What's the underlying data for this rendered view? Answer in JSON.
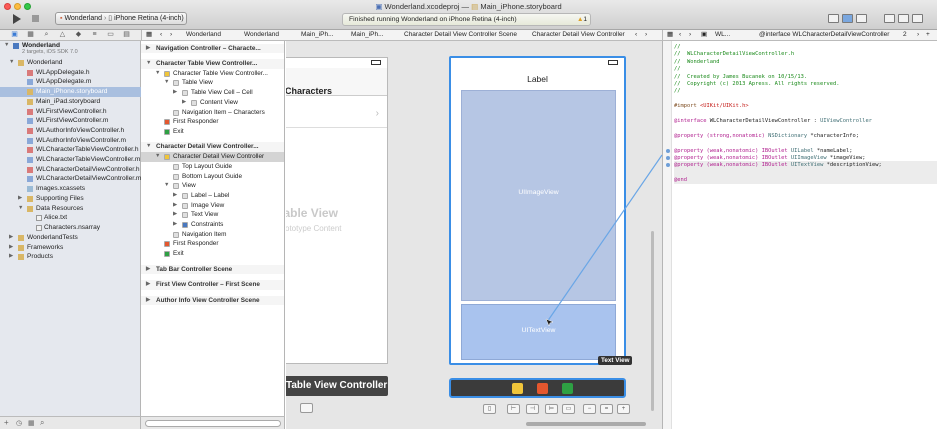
{
  "window": {
    "title_left": "Wonderland.xcodeproj",
    "title_sep": "—",
    "title_right": "Main_iPhone.storyboard"
  },
  "toolbar": {
    "scheme": "Wonderland",
    "destination": "iPhone Retina (4-inch)",
    "activity": "Finished running Wonderland on iPhone Retina (4-inch)",
    "warning_count": "1"
  },
  "jumpbar": {
    "crumbs": [
      "Wonderland",
      "Wonderland",
      "Main_iPh...",
      "Main_iPh...",
      "Character Detail View Controller Scene",
      "Character Detail View Controller"
    ],
    "assistant_crumbs": [
      "WL...",
      "@interface WLCharacterDetailViewController",
      "2"
    ]
  },
  "navigator": {
    "project": "Wonderland",
    "project_sub": "2 targets, iOS SDK 7.0",
    "group": "Wonderland",
    "files": [
      "WLAppDelegate.h",
      "WLAppDelegate.m",
      "Main_iPhone.storyboard",
      "Main_iPad.storyboard",
      "WLFirstViewController.h",
      "WLFirstViewController.m",
      "WLAuthorInfoViewController.h",
      "WLAuthorInfoViewController.m",
      "WLCharacterTableViewController.h",
      "WLCharacterTableViewController.m",
      "WLCharacterDetailViewController.h",
      "WLCharacterDetailViewController.m",
      "Images.xcassets"
    ],
    "supporting": "Supporting Files",
    "data_resources": "Data Resources",
    "data_files": [
      "Alice.txt",
      "Characters.nsarray"
    ],
    "tests": "WonderlandTests",
    "frameworks": "Frameworks",
    "products": "Products"
  },
  "outline": {
    "items": [
      {
        "label": "Navigation Controller – Characte...",
        "level": 0,
        "scene": true
      },
      {
        "label": "Character Table View Controller...",
        "level": 0,
        "scene": true
      },
      {
        "label": "Character Table View Controller...",
        "level": 1
      },
      {
        "label": "Table View",
        "level": 2
      },
      {
        "label": "Table View Cell – Cell",
        "level": 3
      },
      {
        "label": "Content View",
        "level": 4
      },
      {
        "label": "Navigation Item – Characters",
        "level": 2
      },
      {
        "label": "First Responder",
        "level": 1
      },
      {
        "label": "Exit",
        "level": 1
      },
      {
        "label": "Character Detail View Controller...",
        "level": 0,
        "scene": true
      },
      {
        "label": "Character Detail View Controller",
        "level": 1,
        "selected": true
      },
      {
        "label": "Top Layout Guide",
        "level": 2
      },
      {
        "label": "Bottom Layout Guide",
        "level": 2
      },
      {
        "label": "View",
        "level": 2
      },
      {
        "label": "Label – Label",
        "level": 3
      },
      {
        "label": "Image View",
        "level": 3
      },
      {
        "label": "Text View",
        "level": 3
      },
      {
        "label": "Constraints",
        "level": 3
      },
      {
        "label": "Navigation Item",
        "level": 2
      },
      {
        "label": "First Responder",
        "level": 1
      },
      {
        "label": "Exit",
        "level": 1
      },
      {
        "label": "Tab Bar Controller Scene",
        "level": 0,
        "scene": true
      },
      {
        "label": "First View Controller – First Scene",
        "level": 0,
        "scene": true
      },
      {
        "label": "Author Info View Controller Scene",
        "level": 0,
        "scene": true
      }
    ]
  },
  "canvas": {
    "tv_title": "Characters",
    "tv_watermark": "Table View",
    "tv_watermark_sub": "Prototype Content",
    "tv_bar": "Table View Controller",
    "detail_label": "Label",
    "image_view_label": "UIImageView",
    "text_view_label": "UITextView",
    "tooltip": "Text View"
  },
  "code": [
    {
      "t": "//",
      "c": "com"
    },
    {
      "t": "//  WLCharacterDetailViewController.h",
      "c": "com"
    },
    {
      "t": "//  Wonderland",
      "c": "com"
    },
    {
      "t": "//",
      "c": "com"
    },
    {
      "t": "//  Created by James Bucanek on 10/15/13.",
      "c": "com"
    },
    {
      "t": "//  Copyright (c) 2013 Apress. All rights reserved.",
      "c": "com"
    },
    {
      "t": "//",
      "c": "com"
    },
    {
      "t": "",
      "c": ""
    },
    {
      "t": "#import <UIKit/UIKit.h>",
      "c": "pre"
    },
    {
      "t": "",
      "c": ""
    },
    {
      "t": "@interface WLCharacterDetailViewController : UIViewController",
      "c": "iface"
    },
    {
      "t": "",
      "c": ""
    },
    {
      "t": "@property (strong,nonatomic) NSDictionary *characterInfo;",
      "c": "prop"
    },
    {
      "t": "",
      "c": ""
    },
    {
      "t": "@property (weak,nonatomic) IBOutlet UILabel *nameLabel;",
      "c": "prop"
    },
    {
      "t": "@property (weak,nonatomic) IBOutlet UIImageView *imageView;",
      "c": "prop"
    },
    {
      "t": "@property (weak,nonatomic) IBOutlet UITextView *descriptionView;",
      "c": "prop",
      "hl": true
    },
    {
      "t": "",
      "c": "",
      "hl": true
    },
    {
      "t": "@end",
      "c": "kw",
      "hl": true
    }
  ],
  "colors": {
    "selection": "#a9bfdf",
    "accent": "#3a8ee6",
    "image_view": "#b6c6e4",
    "text_view": "#a9c3ee"
  }
}
